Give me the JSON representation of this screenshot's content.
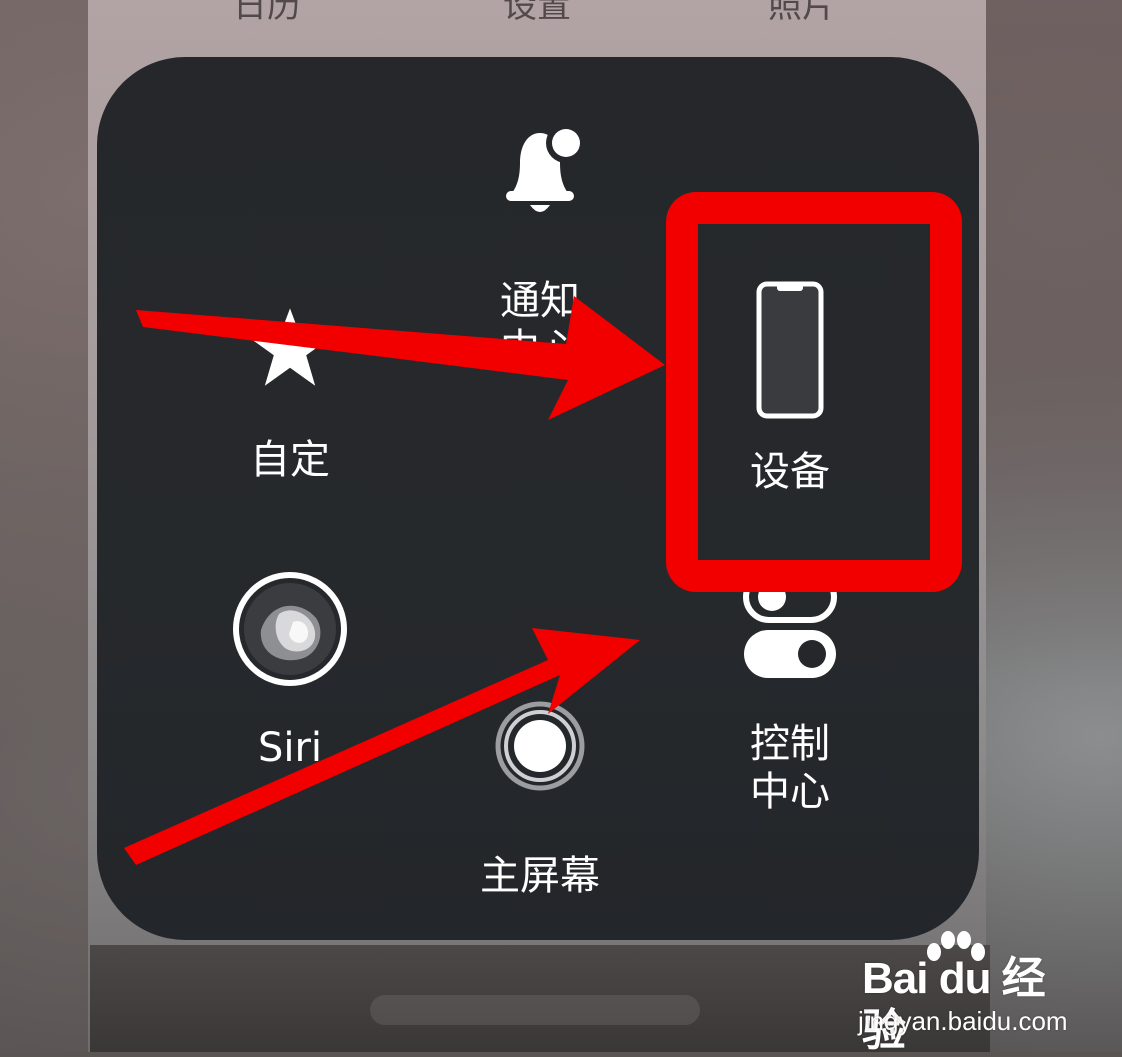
{
  "background": {
    "top_labels": [
      "日历",
      "设置",
      "照片"
    ]
  },
  "assistive_touch_menu": {
    "items": [
      {
        "id": "notification_center",
        "label": "通知\n中心",
        "icon": "bell-icon"
      },
      {
        "id": "custom",
        "label": "自定",
        "icon": "star-icon"
      },
      {
        "id": "device",
        "label": "设备",
        "icon": "iphone-icon"
      },
      {
        "id": "siri",
        "label": "Siri",
        "icon": "siri-icon"
      },
      {
        "id": "home",
        "label": "主屏幕",
        "icon": "home-button-icon"
      },
      {
        "id": "control_center",
        "label": "控制\n中心",
        "icon": "toggle-switches-icon"
      }
    ]
  },
  "annotations": {
    "highlight_color": "#f20000",
    "highlighted_item": "device",
    "arrow_count": 2
  },
  "watermark": {
    "brand": "Bai du 经验",
    "url": "jingyan.baidu.com"
  },
  "colors": {
    "menu_background": "#25272b",
    "icon": "#ffffff",
    "highlight": "#f20000"
  }
}
